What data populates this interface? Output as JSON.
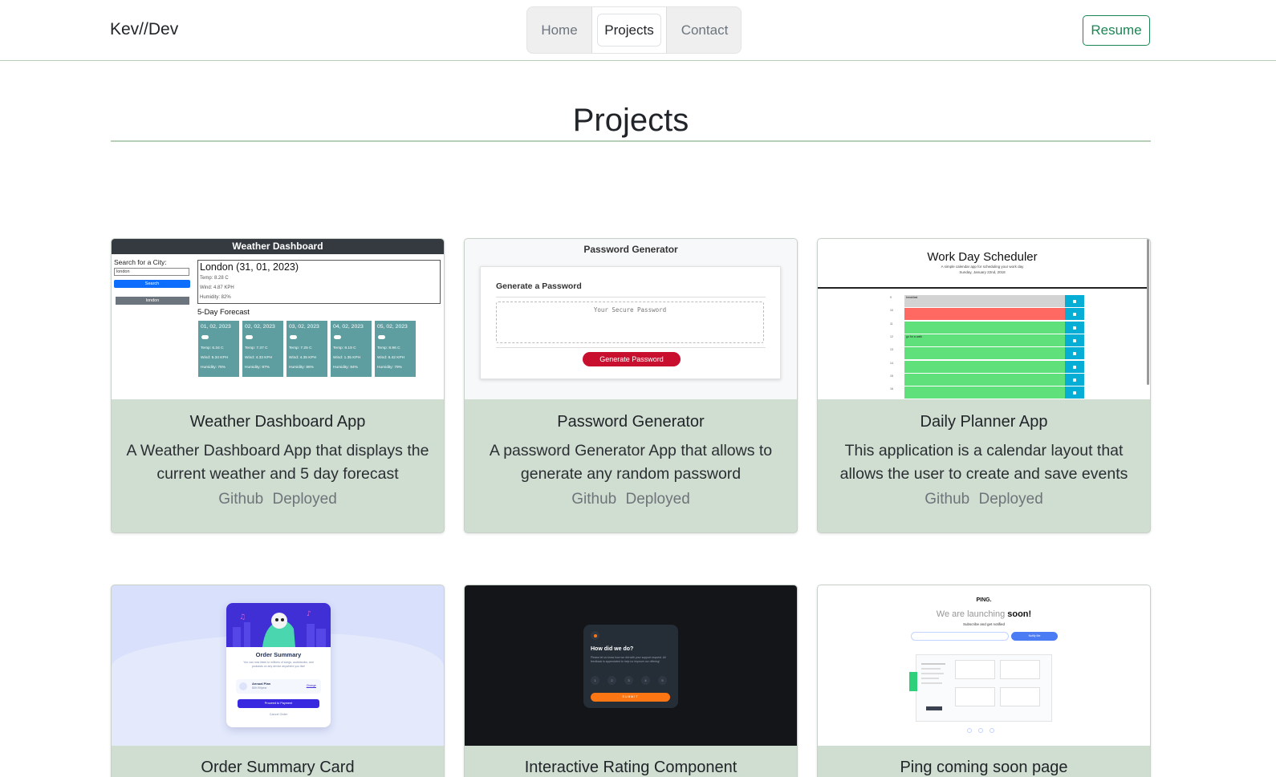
{
  "nav": {
    "brand": "Kev//Dev",
    "tabs": [
      {
        "label": "Home"
      },
      {
        "label": "Projects"
      },
      {
        "label": "Contact"
      }
    ],
    "resume_label": "Resume",
    "accent_color": "#198754"
  },
  "page": {
    "title": "Projects"
  },
  "projects": [
    {
      "title": "Weather Dashboard App",
      "description": "A Weather Dashboard App that displays the current weather and 5 day forecast",
      "github_label": "Github",
      "deployed_label": "Deployed",
      "preview": {
        "header": "Weather Dashboard",
        "search_label": "Search for a City:",
        "input_value": "london",
        "search_button": "Search",
        "history_button": "london",
        "city_line": "London (31, 01, 2023)",
        "temp": "Temp: 8.28 C",
        "wind": "Wind: 4.87 KPH",
        "humidity": "Humidity: 82%",
        "forecast_heading": "5-Day Forecast",
        "forecast": [
          {
            "date": "01, 02, 2023",
            "temp": "Temp: 6.34 C",
            "wind": "Wind: 5.34 KPH",
            "humidity": "Humidity: 75%"
          },
          {
            "date": "02, 02, 2023",
            "temp": "Temp: 7.37 C",
            "wind": "Wind: 4.33 KPH",
            "humidity": "Humidity: 87%"
          },
          {
            "date": "03, 02, 2023",
            "temp": "Temp: 7.25 C",
            "wind": "Wind: 4.35 KPH",
            "humidity": "Humidity: 86%"
          },
          {
            "date": "04, 02, 2023",
            "temp": "Temp: 8.19 C",
            "wind": "Wind: 1.35 KPH",
            "humidity": "Humidity: 84%"
          },
          {
            "date": "05, 02, 2023",
            "temp": "Temp: 8.96 C",
            "wind": "Wind: 6.42 KPH",
            "humidity": "Humidity: 79%"
          }
        ]
      }
    },
    {
      "title": "Password Generator",
      "description": "A password Generator App that allows to generate any random password",
      "github_label": "Github",
      "deployed_label": "Deployed",
      "preview": {
        "header": "Password Generator",
        "subheader": "Generate a Password",
        "placeholder": "Your Secure Password",
        "button": "Generate Password"
      }
    },
    {
      "title": "Daily Planner App",
      "description": "This application is a calendar layout that allows the user to create and save events",
      "github_label": "Github",
      "deployed_label": "Deployed",
      "preview": {
        "header": "Work Day Scheduler",
        "tagline": "A simple calendar app for scheduling your work day",
        "date": "Sunday, January 22nd, 2018",
        "rows": [
          {
            "hour": "9",
            "text": "breakfast"
          },
          {
            "hour": "10",
            "text": ""
          },
          {
            "hour": "11",
            "text": ""
          },
          {
            "hour": "12",
            "text": "go for a walk"
          },
          {
            "hour": "13",
            "text": ""
          },
          {
            "hour": "14",
            "text": ""
          },
          {
            "hour": "15",
            "text": ""
          },
          {
            "hour": "16",
            "text": ""
          }
        ]
      }
    },
    {
      "title": "Order Summary Card",
      "preview": {
        "heading": "Order Summary",
        "body": "You can now listen to millions of songs, audiobooks, and podcasts on any device anywhere you like!",
        "plan": "Annual Plan",
        "price": "$59.99/year",
        "change": "Change",
        "button": "Proceed to Payment",
        "cancel": "Cancel Order"
      }
    },
    {
      "title": "Interactive Rating Component",
      "preview": {
        "heading": "How did we do?",
        "body": "Please let us know how we did with your support request. All feedback is appreciated to help us improve our offering!",
        "ratings": [
          "1",
          "2",
          "3",
          "4",
          "5"
        ],
        "button": "SUBMIT"
      }
    },
    {
      "title": "Ping coming soon page",
      "preview": {
        "logo": "PING.",
        "headline_light": "We are launching",
        "headline_bold": "soon!",
        "sub": "Subscribe and get notified",
        "button": "Notify Me"
      }
    }
  ]
}
